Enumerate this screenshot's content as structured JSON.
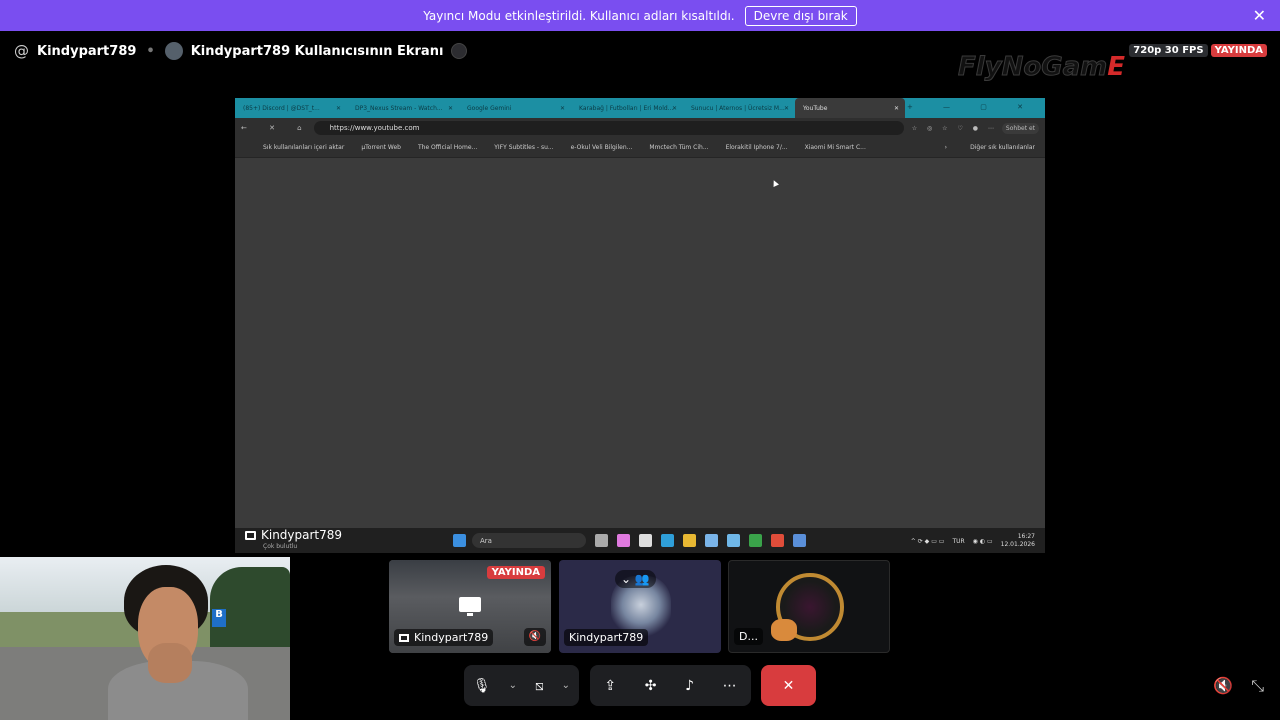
{
  "banner": {
    "message": "Yayıncı Modu etkinleştirildi. Kullanıcı adları kısaltıldı.",
    "button": "Devre dışı bırak",
    "close": "✕"
  },
  "header": {
    "at_symbol": "@",
    "channel": "Kindypart789",
    "separator": "•",
    "screen_title": "Kindypart789 Kullanıcısının Ekranı",
    "quality": "720p 30 FPS",
    "live_badge": "YAYINDA"
  },
  "logo": {
    "text_main": "FlyNoGam",
    "text_accent": "E"
  },
  "screenshare": {
    "tabs": [
      {
        "label": "(85+) Discord | @DST_t..."
      },
      {
        "label": "DP3_Nexus Stream - Watch..."
      },
      {
        "label": "Google Gemini"
      },
      {
        "label": "Karabağ | Futbolları | Eri Mold..."
      },
      {
        "label": "Sunucu | Aternos | Ücretsiz M..."
      },
      {
        "label": "YouTube"
      }
    ],
    "window_controls": "+ — ▢ ✕",
    "nav": "← ✕ ⌂",
    "url": "https://www.youtube.com",
    "toolbar_icons": "☆ ◎ ☆ ♡ ●  ⋯",
    "chat_button": "Sohbet et",
    "bookmarks": [
      "Sık kullanılanları içeri aktar",
      "µTorrent Web",
      "The Official Home...",
      "YIFY Subtitles - su...",
      "e-Okul Veli Bilgilen...",
      "Mmctech Tüm Cih...",
      "Elorakitil Iphone 7/...",
      "Xiaomi Mi Smart C..."
    ],
    "bookmarks_chevron": "›",
    "other_bookmarks": "Diğer sık kullanılanlar",
    "taskbar": {
      "user": "Kindypart789",
      "user_sub": "Çok bulutlu",
      "search": "Ara",
      "lang": "TUR",
      "time": "16:27",
      "date": "12.01.2026"
    }
  },
  "tiles": [
    {
      "name": "Kindypart789",
      "badge": "YAYINDA"
    },
    {
      "name": "Kindypart789"
    },
    {
      "name": "D..."
    }
  ],
  "webcam": {
    "sign": "B"
  },
  "controls": {
    "mic": "🎙",
    "chevron": "⌄",
    "camera": "⧅",
    "share": "⇪",
    "activities": "✣",
    "soundboard": "♪",
    "more": "⋯",
    "leave": "✕"
  },
  "corner": {
    "deafen": "🔇",
    "exit_fullscreen": "⤡"
  }
}
